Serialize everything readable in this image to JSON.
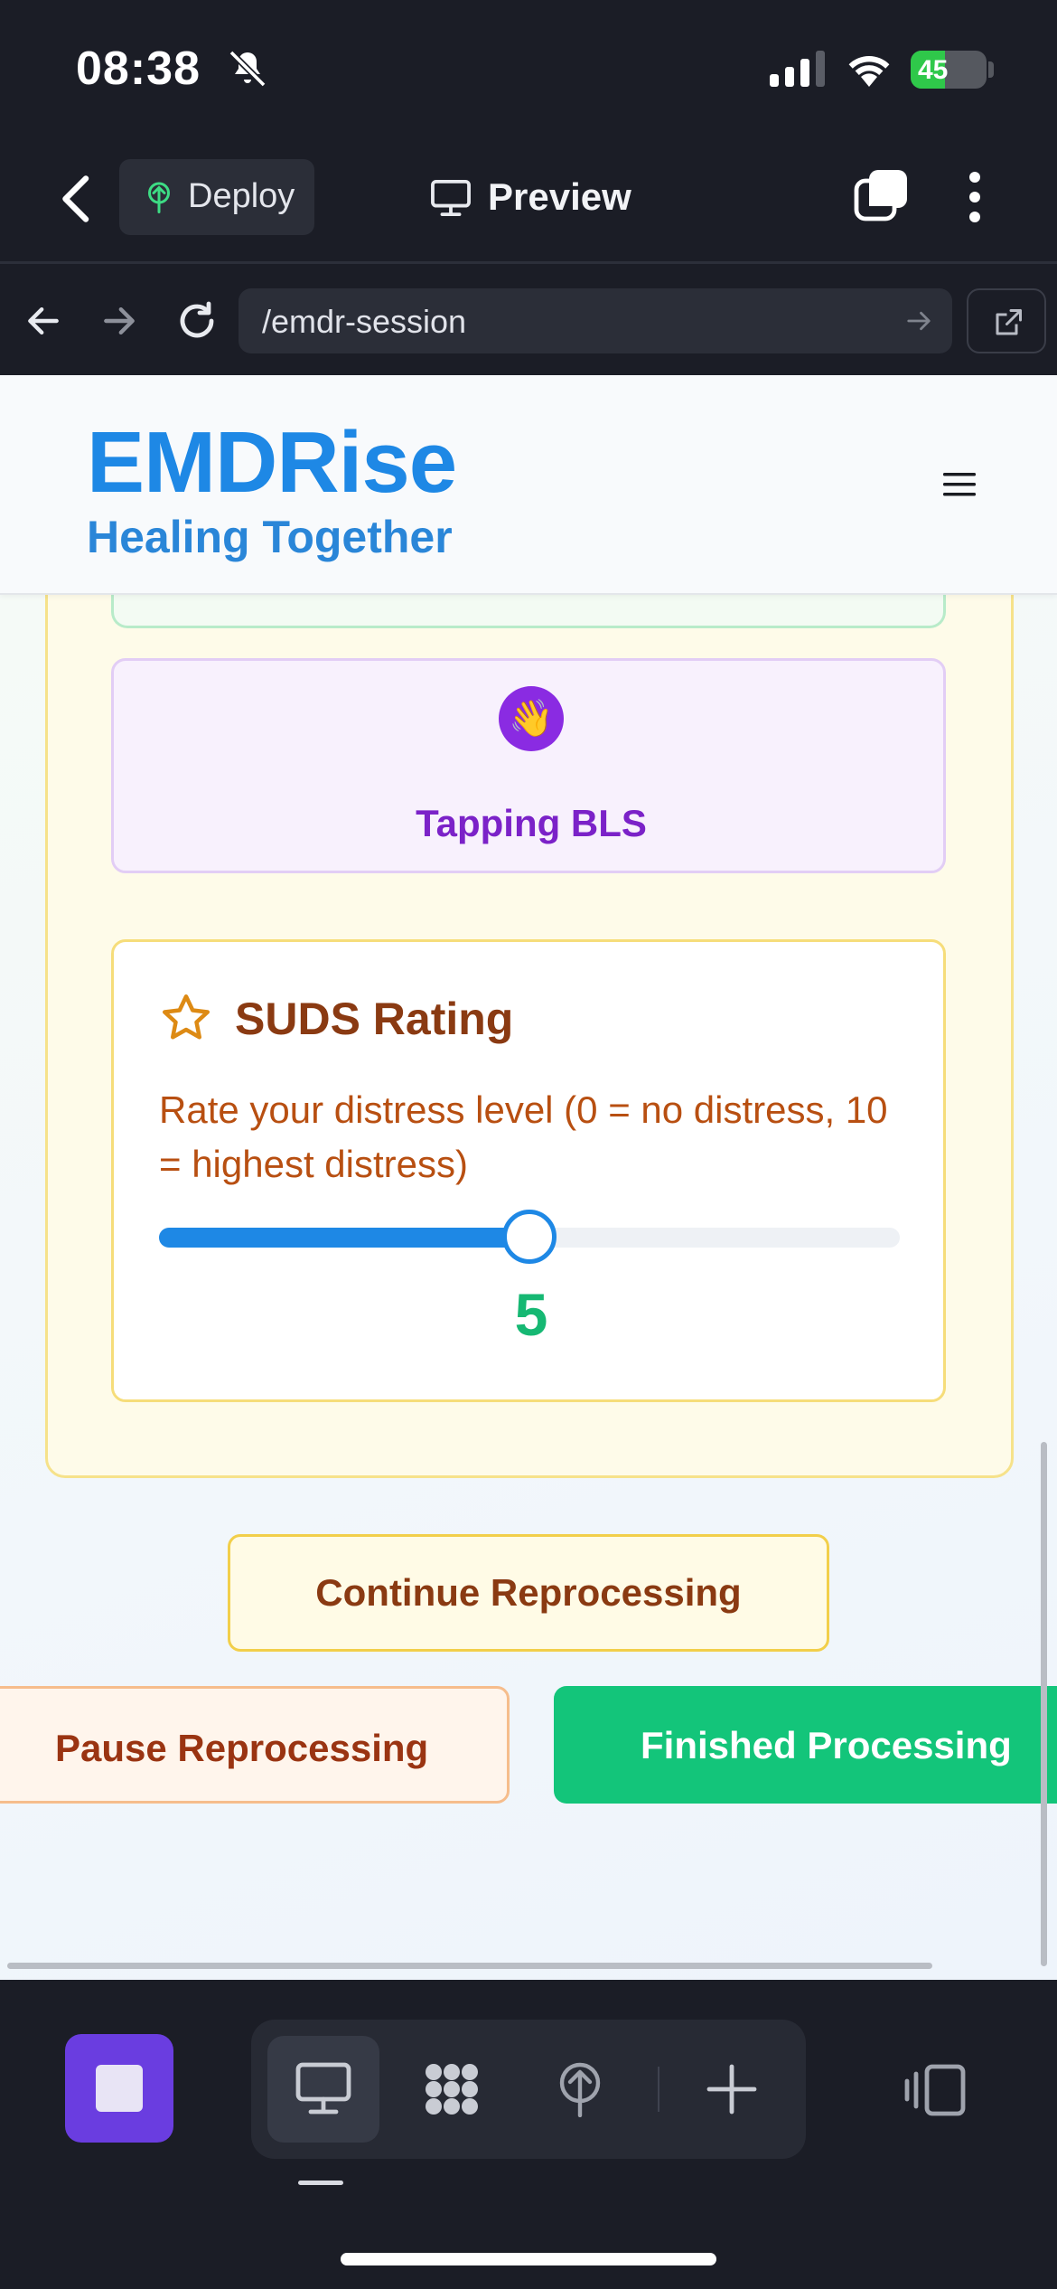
{
  "status_bar": {
    "time": "08:38",
    "battery_percent": "45",
    "battery_level": 0.45,
    "icons": [
      "bell-slash-icon",
      "cellular-signal-icon",
      "wifi-icon",
      "battery-charging-icon"
    ]
  },
  "app_bar": {
    "deploy_label": "Deploy",
    "preview_label": "Preview",
    "icons": [
      "chevron-left-icon",
      "deploy-icon",
      "monitor-icon",
      "tabs-icon",
      "more-vertical-icon"
    ]
  },
  "browser": {
    "url": "/emdr-session",
    "icons": [
      "arrow-left-icon",
      "arrow-right-icon",
      "reload-icon",
      "go-arrow-icon",
      "external-link-icon"
    ]
  },
  "site": {
    "brand": "EMDRise",
    "tagline": "Healing Together",
    "menu_icon": "hamburger-menu-icon"
  },
  "bls": {
    "icon": "👋",
    "label": "Tapping BLS"
  },
  "suds": {
    "icon": "star-icon",
    "title": "SUDS Rating",
    "description": "Rate your distress level (0 = no distress, 10 = highest distress)",
    "min": 0,
    "max": 10,
    "value": 5,
    "value_label": "5"
  },
  "actions": {
    "continue_label": "Continue Reprocessing",
    "pause_label": "Pause Reprocessing",
    "finished_label": "Finished Processing"
  },
  "bottom_toolbar": {
    "icons": [
      "stop-icon",
      "desktop-preview-icon",
      "apps-grid-icon",
      "deploy-icon",
      "plus-icon",
      "side-panel-icon"
    ]
  },
  "colors": {
    "brand_blue": "#1e88e5",
    "accent_green": "#13c57a",
    "purple": "#7b22c8",
    "amber_brown": "#8a3a12",
    "stop_purple": "#6a3de0"
  }
}
